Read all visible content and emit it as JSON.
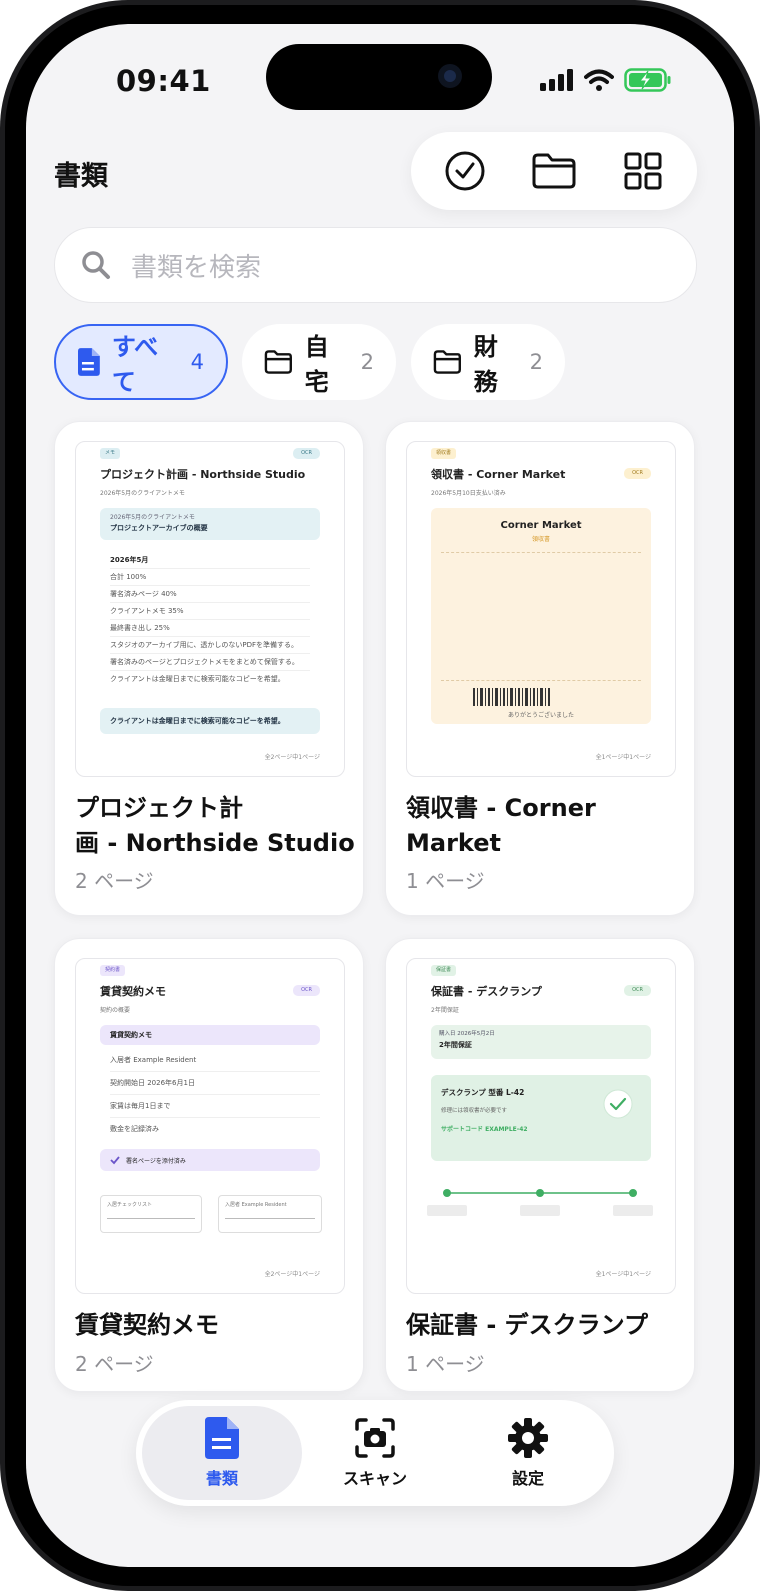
{
  "status_bar": {
    "time": "09:41"
  },
  "header": {
    "title": "書類"
  },
  "search": {
    "placeholder": "書類を検索"
  },
  "filters": [
    {
      "label": "すべて",
      "count": "4",
      "active": true
    },
    {
      "label": "自宅",
      "count": "2",
      "active": false
    },
    {
      "label": "財務",
      "count": "2",
      "active": false
    }
  ],
  "documents": [
    {
      "title_line1": "プロジェクト計",
      "title_line2": "画 - Northside Studio",
      "pages": "2 ページ",
      "preview": {
        "tag": "メモ",
        "ocr": "OCR",
        "heading": "プロジェクト計画 - Northside Studio",
        "subheading": "2026年5月のクライアントメモ",
        "box_small": "2026年5月のクライアントメモ",
        "box_title": "プロジェクトアーカイブの概要",
        "month": "2026年5月",
        "lines": [
          "合計 100%",
          "署名済みページ 40%",
          "クライアントメモ 35%",
          "最終書き出し 25%",
          "スタジオのアーカイブ用に、透かしのないPDFを準備する。",
          "署名済みのページとプロジェクトメモをまとめて保管する。",
          "クライアントは金曜日までに検索可能なコピーを希望。"
        ],
        "callout": "クライアントは金曜日までに検索可能なコピーを希望。",
        "footer": "全2ページ中1ページ"
      }
    },
    {
      "title_line1": "領収書 - Corner",
      "title_line2": "Market",
      "pages": "1 ページ",
      "preview": {
        "tag": "領収書",
        "ocr": "OCR",
        "heading": "領収書 - Corner Market",
        "subheading": "2026年5月10日支払い済み",
        "store": "Corner Market",
        "receipt_label": "領収書",
        "thanks": "ありがとうございました",
        "footer": "全1ページ中1ページ"
      }
    },
    {
      "title_line1": "賃貸契約メモ",
      "pages": "2 ページ",
      "preview": {
        "tag": "契約書",
        "ocr": "OCR",
        "heading": "賃貸契約メモ",
        "subheading": "契約の概要",
        "box_title": "賃貸契約メモ",
        "lines": [
          "入居者 Example Resident",
          "契約開始日 2026年6月1日",
          "家賃は毎月1日まで",
          "敷金を記録済み"
        ],
        "checked": "署名ページを添付済み",
        "field1": "入居チェックリスト",
        "field2": "入居者 Example Resident",
        "footer": "全2ページ中1ページ"
      }
    },
    {
      "title_line1": "保証書 - デスクランプ",
      "pages": "1 ページ",
      "preview": {
        "tag": "保証書",
        "ocr": "OCR",
        "heading": "保証書 - デスクランプ",
        "subheading": "2年間保証",
        "box_small": "購入日 2026年5月2日",
        "box_title": "2年間保証",
        "product": "デスクランプ 型番 L-42",
        "note": "修理には領収書が必要です",
        "support": "サポートコード EXAMPLE-42",
        "footer": "全1ページ中1ページ"
      }
    }
  ],
  "tabbar": [
    {
      "label": "書類",
      "icon": "document-icon",
      "active": true
    },
    {
      "label": "スキャン",
      "icon": "scan-camera-icon",
      "active": false
    },
    {
      "label": "設定",
      "icon": "gear-icon",
      "active": false
    }
  ],
  "colors": {
    "accent": "#2e5aee",
    "accent_bg": "#e3eaff",
    "background": "#f4f4f6",
    "battery": "#34c759"
  }
}
